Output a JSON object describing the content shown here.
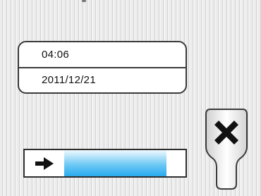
{
  "info": {
    "time": "04:06",
    "date": "2011/12/21"
  },
  "progress": {
    "percent": 88,
    "direction_icon": "right-arrow-icon",
    "fill_color": "#29aaee"
  },
  "close_button": {
    "icon": "close-icon"
  }
}
